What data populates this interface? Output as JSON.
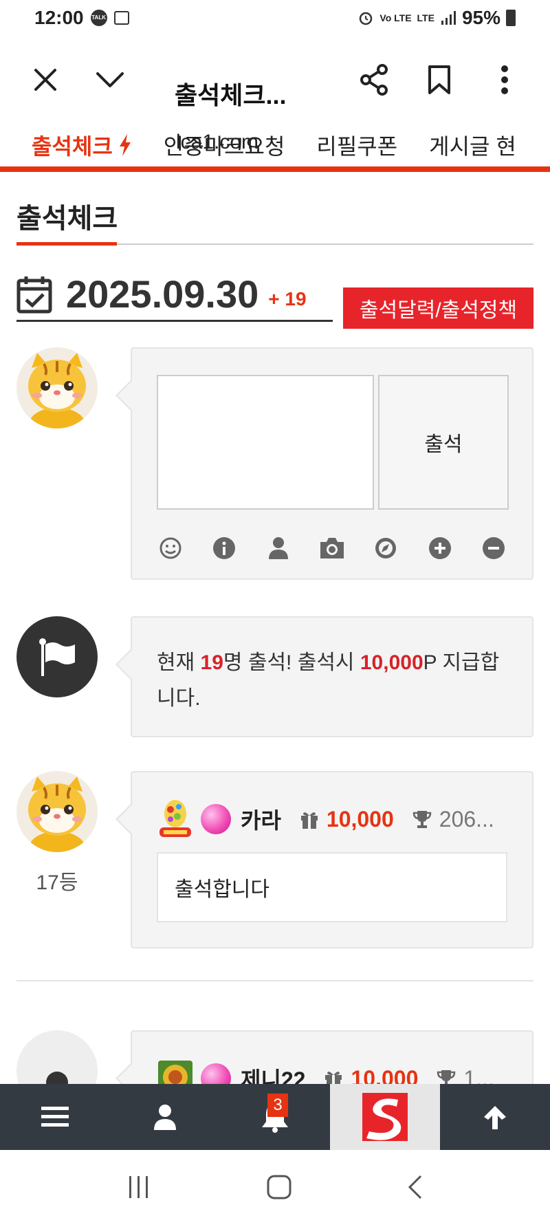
{
  "status_bar": {
    "time": "12:00",
    "talk_label": "TALK",
    "volte": "Vo LTE",
    "lte": "LTE",
    "battery": "95%"
  },
  "browser": {
    "title": "출석체크...",
    "url": "lca1.com"
  },
  "nav_tabs": [
    {
      "label": "출석체크"
    },
    {
      "label": "인증마크요청"
    },
    {
      "label": "리필쿠폰"
    },
    {
      "label": "게시글 현"
    }
  ],
  "section": {
    "title": "출석체크"
  },
  "date": {
    "value": "2025.09.30",
    "plus": "+ 19"
  },
  "policy_button": "출석달력/출석정책",
  "comment_box": {
    "attend_label": "출석",
    "value": ""
  },
  "notice": {
    "prefix": "현재 ",
    "count": "19",
    "mid": "명 출석! 출석시 ",
    "points": "10,000",
    "suffix": "P 지급합니다."
  },
  "entries": [
    {
      "nickname": "카라",
      "points": "10,000",
      "trophy": "206...",
      "message": "출석합니다",
      "rank": "17등"
    },
    {
      "nickname": "제니22",
      "points": "10,000",
      "trophy": "1..."
    }
  ],
  "bottom_nav": {
    "notification_count": "3"
  },
  "colors": {
    "accent": "#e63312",
    "red_button": "#e8242b",
    "dark_bar": "#343a42"
  }
}
